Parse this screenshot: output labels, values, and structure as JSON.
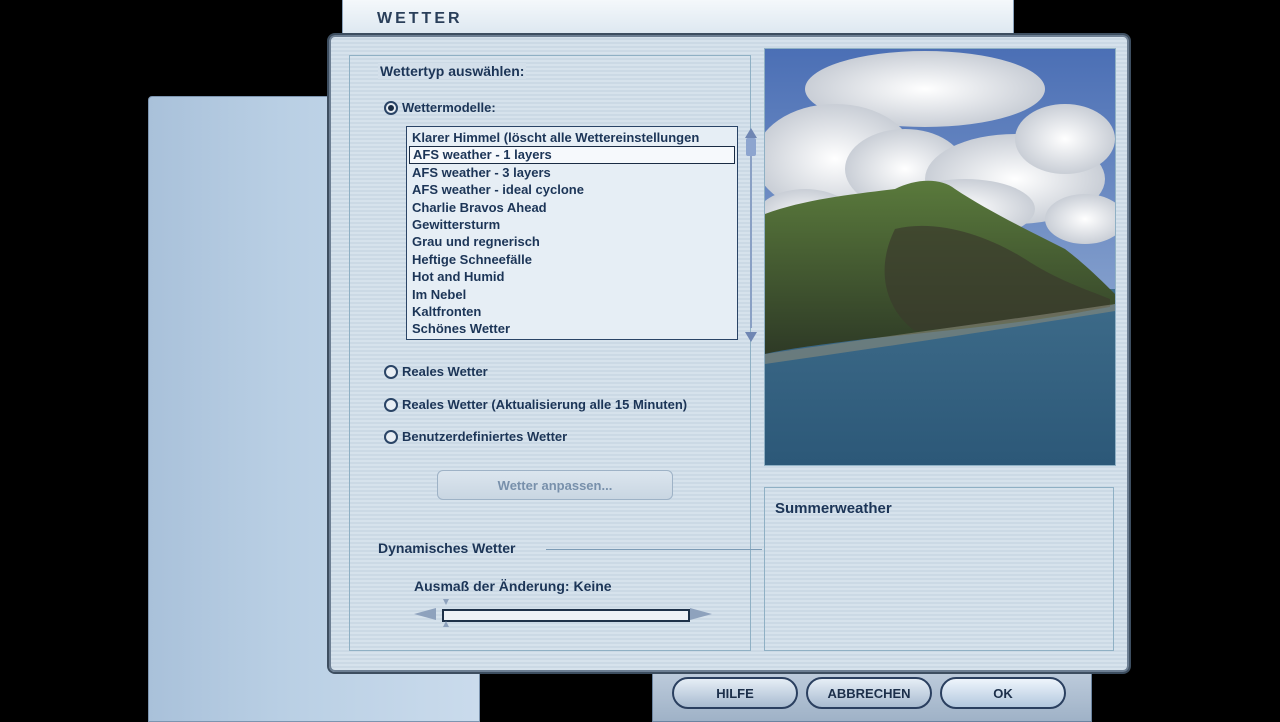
{
  "window": {
    "title": "WETTER"
  },
  "weather_type_group": {
    "label": "Wettertyp auswählen:",
    "options": {
      "models": "Wettermodelle:",
      "real": "Reales Wetter",
      "real_update": "Reales Wetter (Aktualisierung alle 15 Minuten)",
      "custom": "Benutzerdefiniertes Wetter"
    },
    "selected": "models"
  },
  "weather_models_list": {
    "items": [
      "Klarer Himmel (löscht alle Wettereinstellungen",
      "AFS weather - 1 layers",
      "AFS weather - 3 layers",
      "AFS weather - ideal cyclone",
      "Charlie Bravos Ahead",
      "Gewittersturm",
      "Grau und regnerisch",
      "Heftige Schneefälle",
      "Hot and Humid",
      "Im Nebel",
      "Kaltfronten",
      "Schönes Wetter"
    ],
    "selected_index": 1
  },
  "customize_button": {
    "label": "Wetter anpassen..."
  },
  "dynamic_weather": {
    "title": "Dynamisches Wetter",
    "slider_label": "Ausmaß der Änderung: Keine",
    "slider_value": 0
  },
  "description": {
    "title": "Summerweather"
  },
  "footer": {
    "help": "HILFE",
    "cancel": "ABBRECHEN",
    "ok": "OK"
  }
}
